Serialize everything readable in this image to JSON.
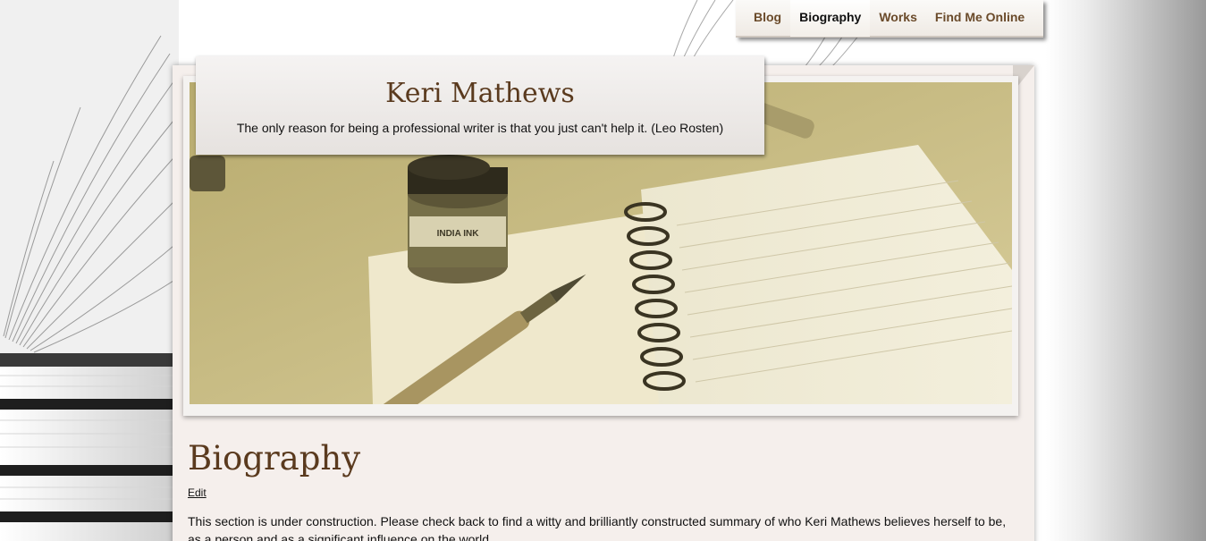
{
  "nav": {
    "items": [
      {
        "label": "Blog",
        "active": false
      },
      {
        "label": "Biography",
        "active": true
      },
      {
        "label": "Works",
        "active": false
      },
      {
        "label": "Find Me Online",
        "active": false
      }
    ]
  },
  "header": {
    "site_title": "Keri Mathews",
    "tagline": "The only reason for being a professional writer is that you just can't help it. (Leo Rosten)"
  },
  "hero": {
    "ink_label": "INDIA INK"
  },
  "main": {
    "heading": "Biography",
    "edit_label": "Edit",
    "body": "This section is under construction. Please check back to find a witty and brilliantly constructed summary of who Keri Mathews believes herself to be, as a person and as a significant influence on the world."
  },
  "colors": {
    "heading_brown": "#5a3a1e",
    "nav_brown": "#6a4a2a",
    "paper": "#f5efec",
    "sepia": "#c2b67f"
  }
}
